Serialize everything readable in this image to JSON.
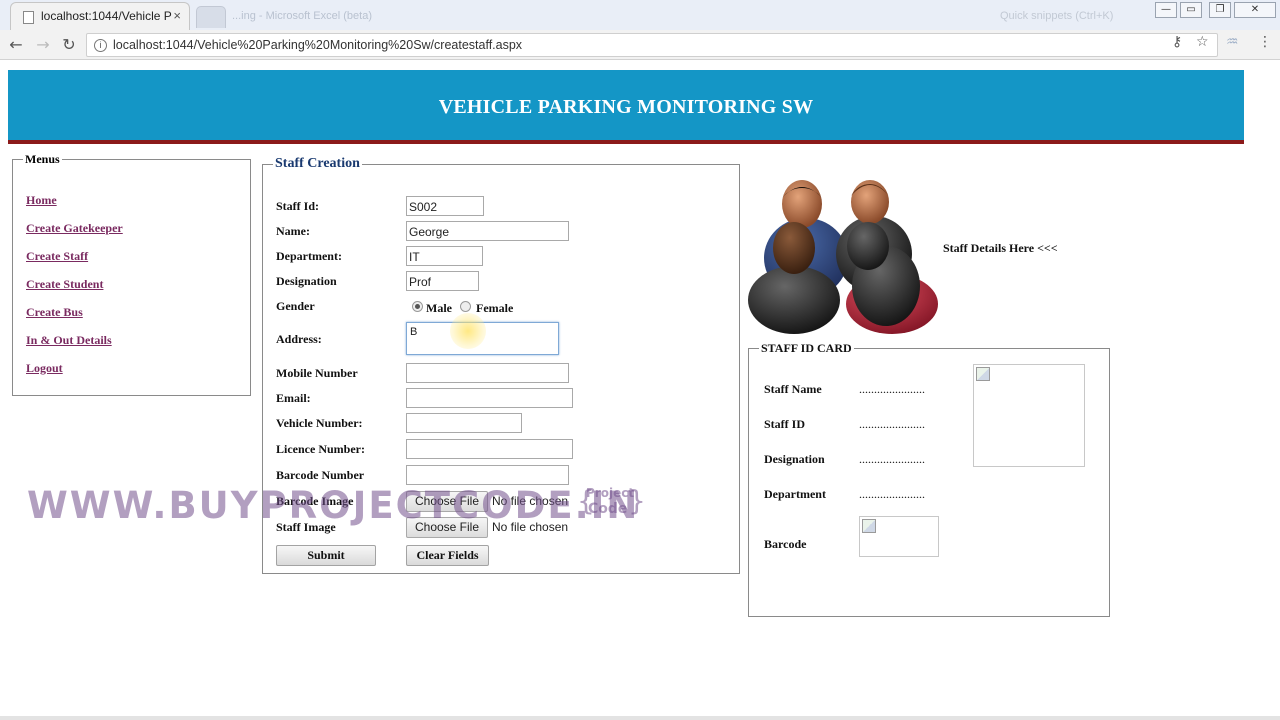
{
  "browser": {
    "tab_title": "localhost:1044/Vehicle P",
    "tab_close": "×",
    "ghost_title": "...ing - Microsoft Excel (beta)",
    "ghost_right": "Quick snippets (Ctrl+K)",
    "url": "localhost:1044/Vehicle%20Parking%20Monitoring%20Sw/createstaff.aspx",
    "window_controls": [
      "minimize",
      "restore",
      "close"
    ]
  },
  "header": {
    "title": "VEHICLE PARKING MONITORING SW"
  },
  "menus": {
    "legend": "Menus",
    "items": [
      {
        "label": "Home"
      },
      {
        "label": "Create Gatekeeper"
      },
      {
        "label": "Create Staff"
      },
      {
        "label": "Create Student"
      },
      {
        "label": "Create Bus"
      },
      {
        "label": "In & Out Details"
      },
      {
        "label": "Logout"
      }
    ]
  },
  "staff_form": {
    "legend": "Staff Creation",
    "staff_id": {
      "label": "Staff Id:",
      "value": "S002"
    },
    "name": {
      "label": "Name:",
      "value": "George"
    },
    "department": {
      "label": "Department:",
      "value": "IT"
    },
    "designation": {
      "label": "Designation",
      "value": "Prof"
    },
    "gender": {
      "label": "Gender",
      "options": [
        "Male",
        "Female"
      ],
      "selected": "Male"
    },
    "address": {
      "label": "Address:",
      "value": "B"
    },
    "mobile": {
      "label": "Mobile Number",
      "value": ""
    },
    "email": {
      "label": "Email:",
      "value": ""
    },
    "vehicle": {
      "label": "Vehicle Number:",
      "value": ""
    },
    "licence": {
      "label": "Licence Number:",
      "value": ""
    },
    "barcode_number": {
      "label": "Barcode Number",
      "value": ""
    },
    "barcode_image": {
      "label": "Barcode Image",
      "button": "Choose File",
      "status": "No file chosen"
    },
    "staff_image": {
      "label": "Staff Image",
      "button": "Choose File",
      "status": "No file chosen"
    },
    "submit": "Submit",
    "clear": "Clear Fields"
  },
  "staff_details": {
    "link": "Staff Details Here <<<"
  },
  "id_card": {
    "legend": "STAFF ID CARD",
    "rows": [
      {
        "label": "Staff Name",
        "value": "......................"
      },
      {
        "label": "Staff ID",
        "value": "......................"
      },
      {
        "label": "Designation",
        "value": "......................"
      },
      {
        "label": "Department",
        "value": "......................"
      }
    ],
    "barcode_label": "Barcode"
  },
  "watermark": {
    "text": "WWW.BUYPROJECTCODE.IN",
    "badge_line1": "Project",
    "badge_line2": "Code"
  },
  "colors": {
    "banner": "#1496c6",
    "banner_border": "#8b1a1a",
    "menu_link": "#7a2a60",
    "legend_blue": "#1a3a70"
  }
}
